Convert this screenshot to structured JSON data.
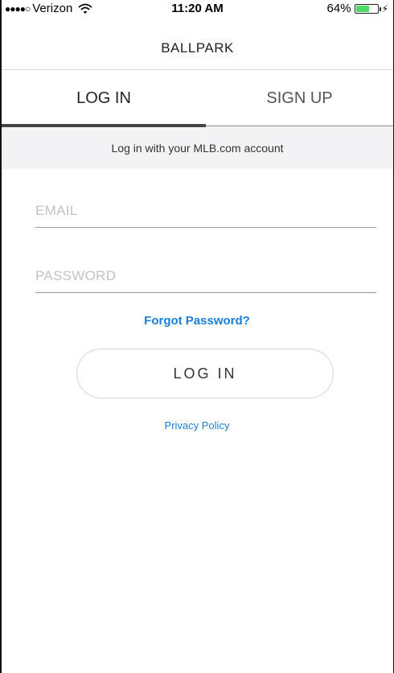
{
  "status_bar": {
    "signal_dots": "●●●●○",
    "carrier": "Verizon",
    "time": "11:20 AM",
    "battery_percent_label": "64%",
    "battery_level": 0.64,
    "battery_color": "#4cd964",
    "icons": [
      "wifi-icon",
      "battery-icon",
      "charging-bolt-icon"
    ]
  },
  "nav": {
    "title": "BALLPARK"
  },
  "tabs": {
    "active": "login",
    "items": [
      {
        "id": "login",
        "label": "LOG IN"
      },
      {
        "id": "signup",
        "label": "SIGN UP"
      }
    ]
  },
  "subtitle": "Log in with your MLB.com account",
  "form": {
    "email": {
      "placeholder": "EMAIL",
      "value": ""
    },
    "password": {
      "placeholder": "PASSWORD",
      "value": ""
    },
    "forgot_label": "Forgot Password?",
    "submit_label": "LOG IN",
    "privacy_label": "Privacy Policy"
  },
  "colors": {
    "link": "#1a7fd8",
    "band_bg": "#f3f3f5",
    "active_tab_indicator": "#444444"
  }
}
